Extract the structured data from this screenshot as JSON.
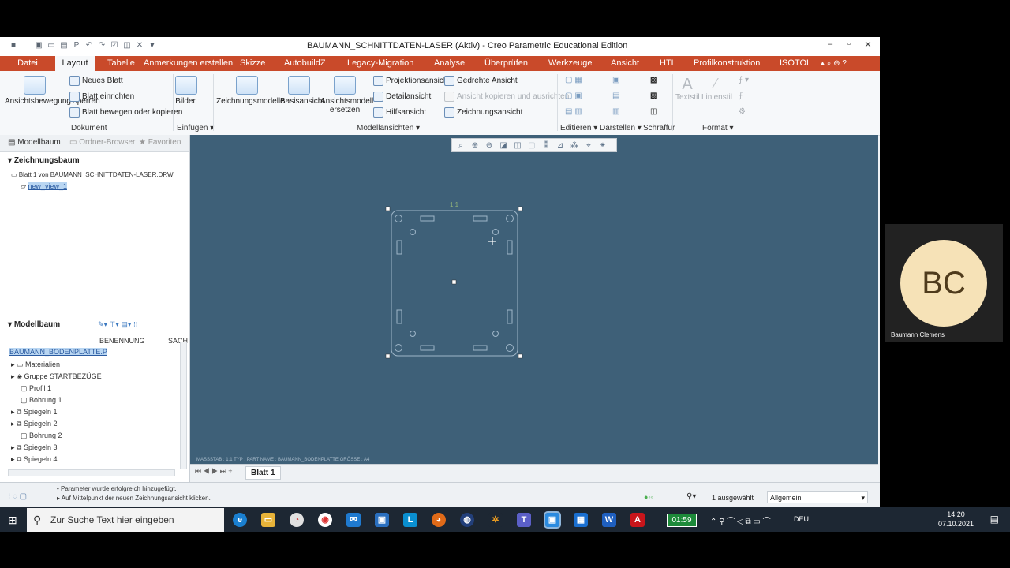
{
  "window": {
    "title": "BAUMANN_SCHNITTDATEN-LASER (Aktiv) - Creo Parametric Educational Edition"
  },
  "menu": {
    "tabs": [
      "Datei",
      "Layout",
      "Tabelle",
      "Anmerkungen erstellen",
      "Skizze",
      "AutobuildZ",
      "Legacy-Migration",
      "Analyse",
      "Überprüfen",
      "Werkzeuge",
      "Ansicht",
      "HTL",
      "Profilkonstruktion",
      "ISOTOL"
    ],
    "active": "Layout"
  },
  "ribbon": {
    "ansichtsbewegung": "Ansichtsbewegung sperren",
    "neues_blatt": "Neues Blatt",
    "blatt_einrichten": "Blatt einrichten",
    "blatt_bewegen": "Blatt bewegen oder kopieren",
    "bilder": "Bilder",
    "zeichnungsmodelle": "Zeichnungsmodelle",
    "basisansicht": "Basisansicht",
    "ansichtsmodell": "Ansichtsmodell ersetzen",
    "projektionsansicht": "Projektionsansicht",
    "gedrehte_ansicht": "Gedrehte Ansicht",
    "detailansicht": "Detailansicht",
    "ansicht_kopieren": "Ansicht kopieren und ausrichten",
    "hilfsansicht": "Hilfsansicht",
    "zeichnungsansicht": "Zeichnungsansicht",
    "textstil": "Textstil",
    "linienstil": "Linienstil",
    "groups": {
      "dokument": "Dokument",
      "einfuegen": "Einfügen",
      "modellansichten": "Modellansichten",
      "editieren": "Editieren",
      "darstellen": "Darstellen",
      "schraffur": "Schraffur",
      "format": "Format"
    }
  },
  "panel_tabs": {
    "modellbaum": "Modellbaum",
    "ordner": "Ordner-Browser",
    "favoriten": "Favoriten"
  },
  "zeichnungsbaum": {
    "title": "Zeichnungsbaum",
    "blatt": "Blatt 1 von BAUMANN_SCHNITTDATEN-LASER.DRW",
    "view": "new_view_1"
  },
  "modellbaum": {
    "title": "Modellbaum",
    "col_benennung": "BENENNUNG",
    "col_sach": "SACH",
    "root": "BAUMANN_BODENPLATTE.P",
    "items": [
      "Materialien",
      "Gruppe STARTBEZÜGE",
      "Profil 1",
      "Bohrung 1",
      "Spiegeln 1",
      "Spiegeln 2",
      "Bohrung 2",
      "Spiegeln 3",
      "Spiegeln 4"
    ]
  },
  "canvas": {
    "scale_label": "1:1",
    "status_line": "MASSSTAB : 1:1     TYP : PART   NAME : BAUMANN_BODENPLATTE    GRÖSSE : A4"
  },
  "sheet": {
    "tab": "Blatt 1"
  },
  "messages": [
    "Parameter wurde erfolgreich hinzugefügt.",
    "Auf Mittelpunkt der neuen Zeichnungsansicht klicken."
  ],
  "selection": {
    "count": "1 ausgewählt",
    "filter": "Allgemein"
  },
  "taskbar": {
    "search_placeholder": "Zur Suche Text hier eingeben",
    "timer": "01:59",
    "lang": "DEU",
    "time": "14:20",
    "date": "07.10.2021"
  },
  "webcam": {
    "initials": "BC",
    "name": "Baumann Clemens"
  },
  "colors": {
    "tab_bar": "#c94a2a",
    "canvas": "#3e6078",
    "taskbar": "#1d2733",
    "avatar": "#f6e2b7"
  }
}
